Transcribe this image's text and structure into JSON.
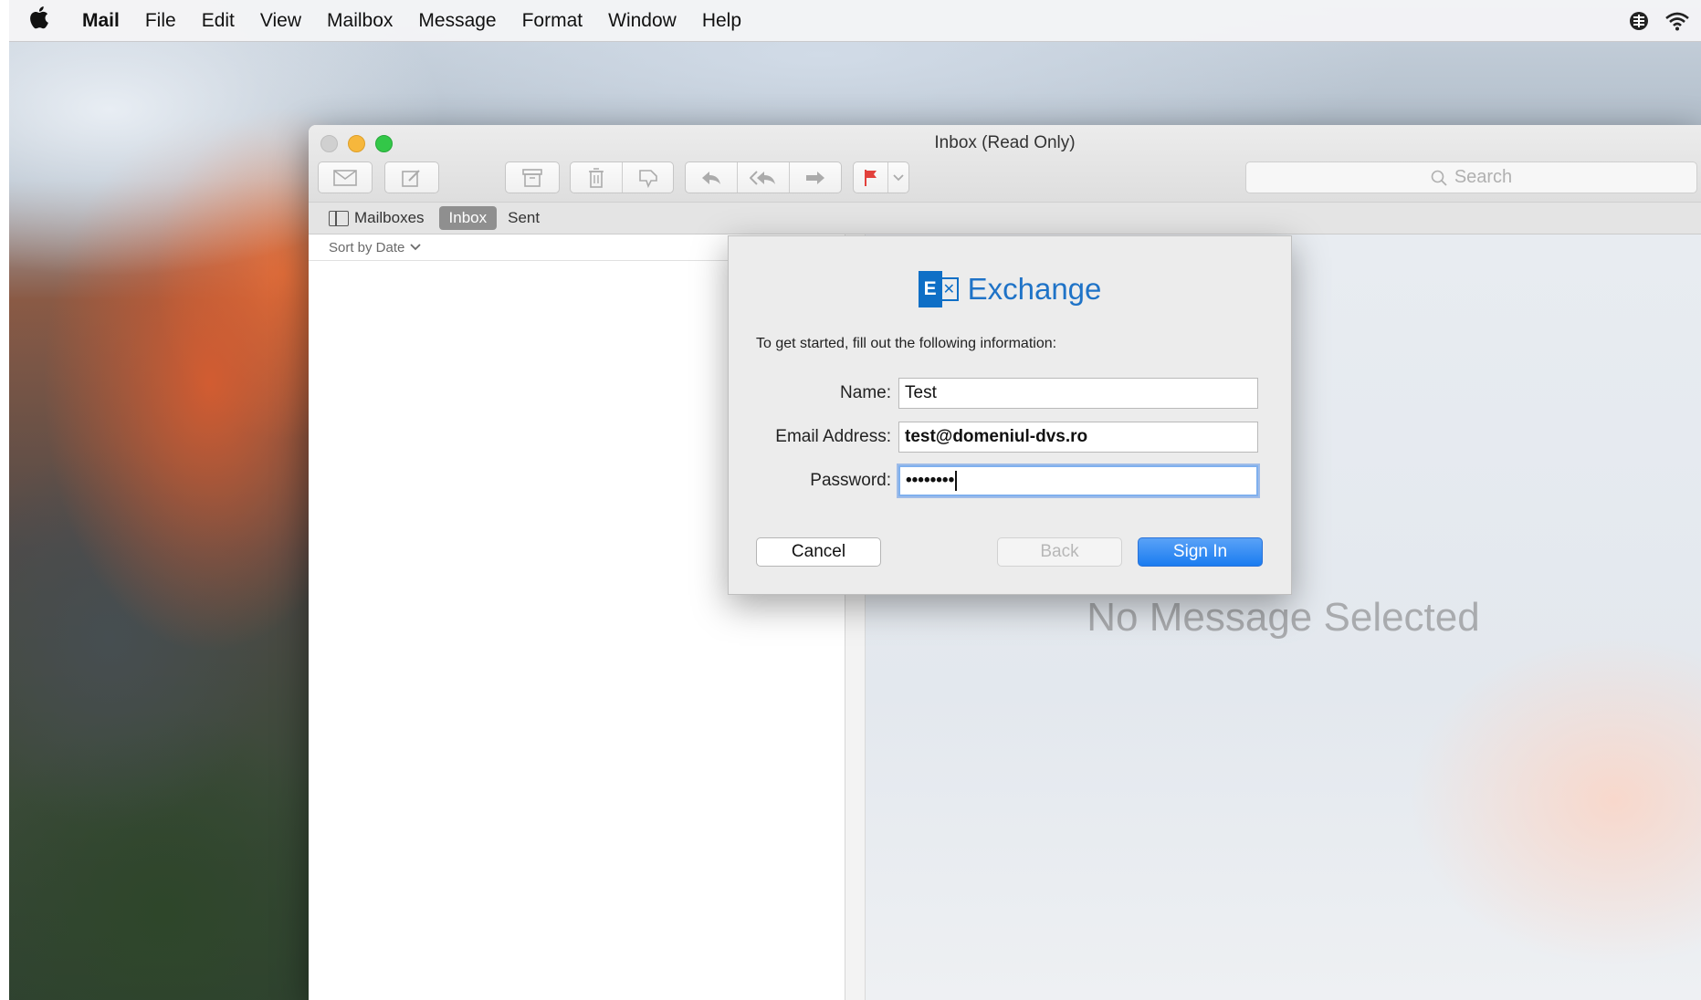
{
  "menubar": {
    "apple_icon": "apple-logo-icon",
    "items": [
      "Mail",
      "File",
      "Edit",
      "View",
      "Mailbox",
      "Message",
      "Format",
      "Window",
      "Help"
    ],
    "status_icons": [
      "keyboard-input-icon",
      "wifi-icon"
    ]
  },
  "window": {
    "title": "Inbox (Read Only)",
    "toolbar": {
      "icons": [
        "get-mail-icon",
        "compose-icon",
        "archive-icon",
        "trash-icon",
        "junk-icon",
        "reply-icon",
        "reply-all-icon",
        "forward-icon",
        "flag-icon",
        "flag-menu-chevron-icon"
      ],
      "search_placeholder": "Search"
    },
    "favorites": {
      "mailboxes_label": "Mailboxes",
      "inbox_label": "Inbox",
      "sent_label": "Sent"
    },
    "sort_label": "Sort by Date",
    "no_message_text": "No Message Selected"
  },
  "dialog": {
    "logo_text": "Exchange",
    "logo_letter": "E",
    "instructions": "To get started, fill out the following information:",
    "fields": {
      "name": {
        "label": "Name:",
        "value": "Test"
      },
      "email": {
        "label": "Email Address:",
        "value": "test@domeniul-dvs.ro"
      },
      "password": {
        "label": "Password:",
        "value": "••••••••"
      }
    },
    "buttons": {
      "cancel": "Cancel",
      "back": "Back",
      "sign_in": "Sign In"
    }
  },
  "colors": {
    "accent": "#1a7cf0",
    "exchange_blue": "#0f6fc6"
  }
}
